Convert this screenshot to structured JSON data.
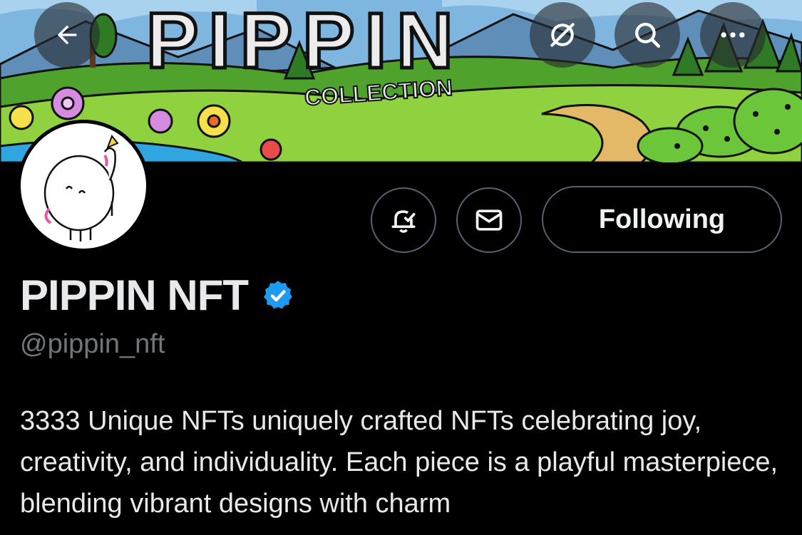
{
  "header": {
    "back_icon": "arrow-left-icon",
    "actions": [
      "no-sync-icon",
      "search-icon",
      "more-icon"
    ]
  },
  "banner": {
    "title": "PIPPIN",
    "subtitle": "COLLECTION"
  },
  "profile": {
    "display_name": "PIPPIN NFT",
    "verified": true,
    "verified_color": "#1d9bf0",
    "handle": "@pippin_nft",
    "bio": "3333 Unique NFTs uniquely crafted NFTs celebrating joy, creativity, and individuality. Each piece is a playful masterpiece, blending vibrant designs with charm"
  },
  "actions": {
    "notifications_icon": "bell-check-icon",
    "message_icon": "mail-icon",
    "follow_label": "Following"
  },
  "colors": {
    "background": "#000000",
    "text": "#e7e9ea",
    "secondary_text": "#71767b",
    "border": "#536471"
  }
}
